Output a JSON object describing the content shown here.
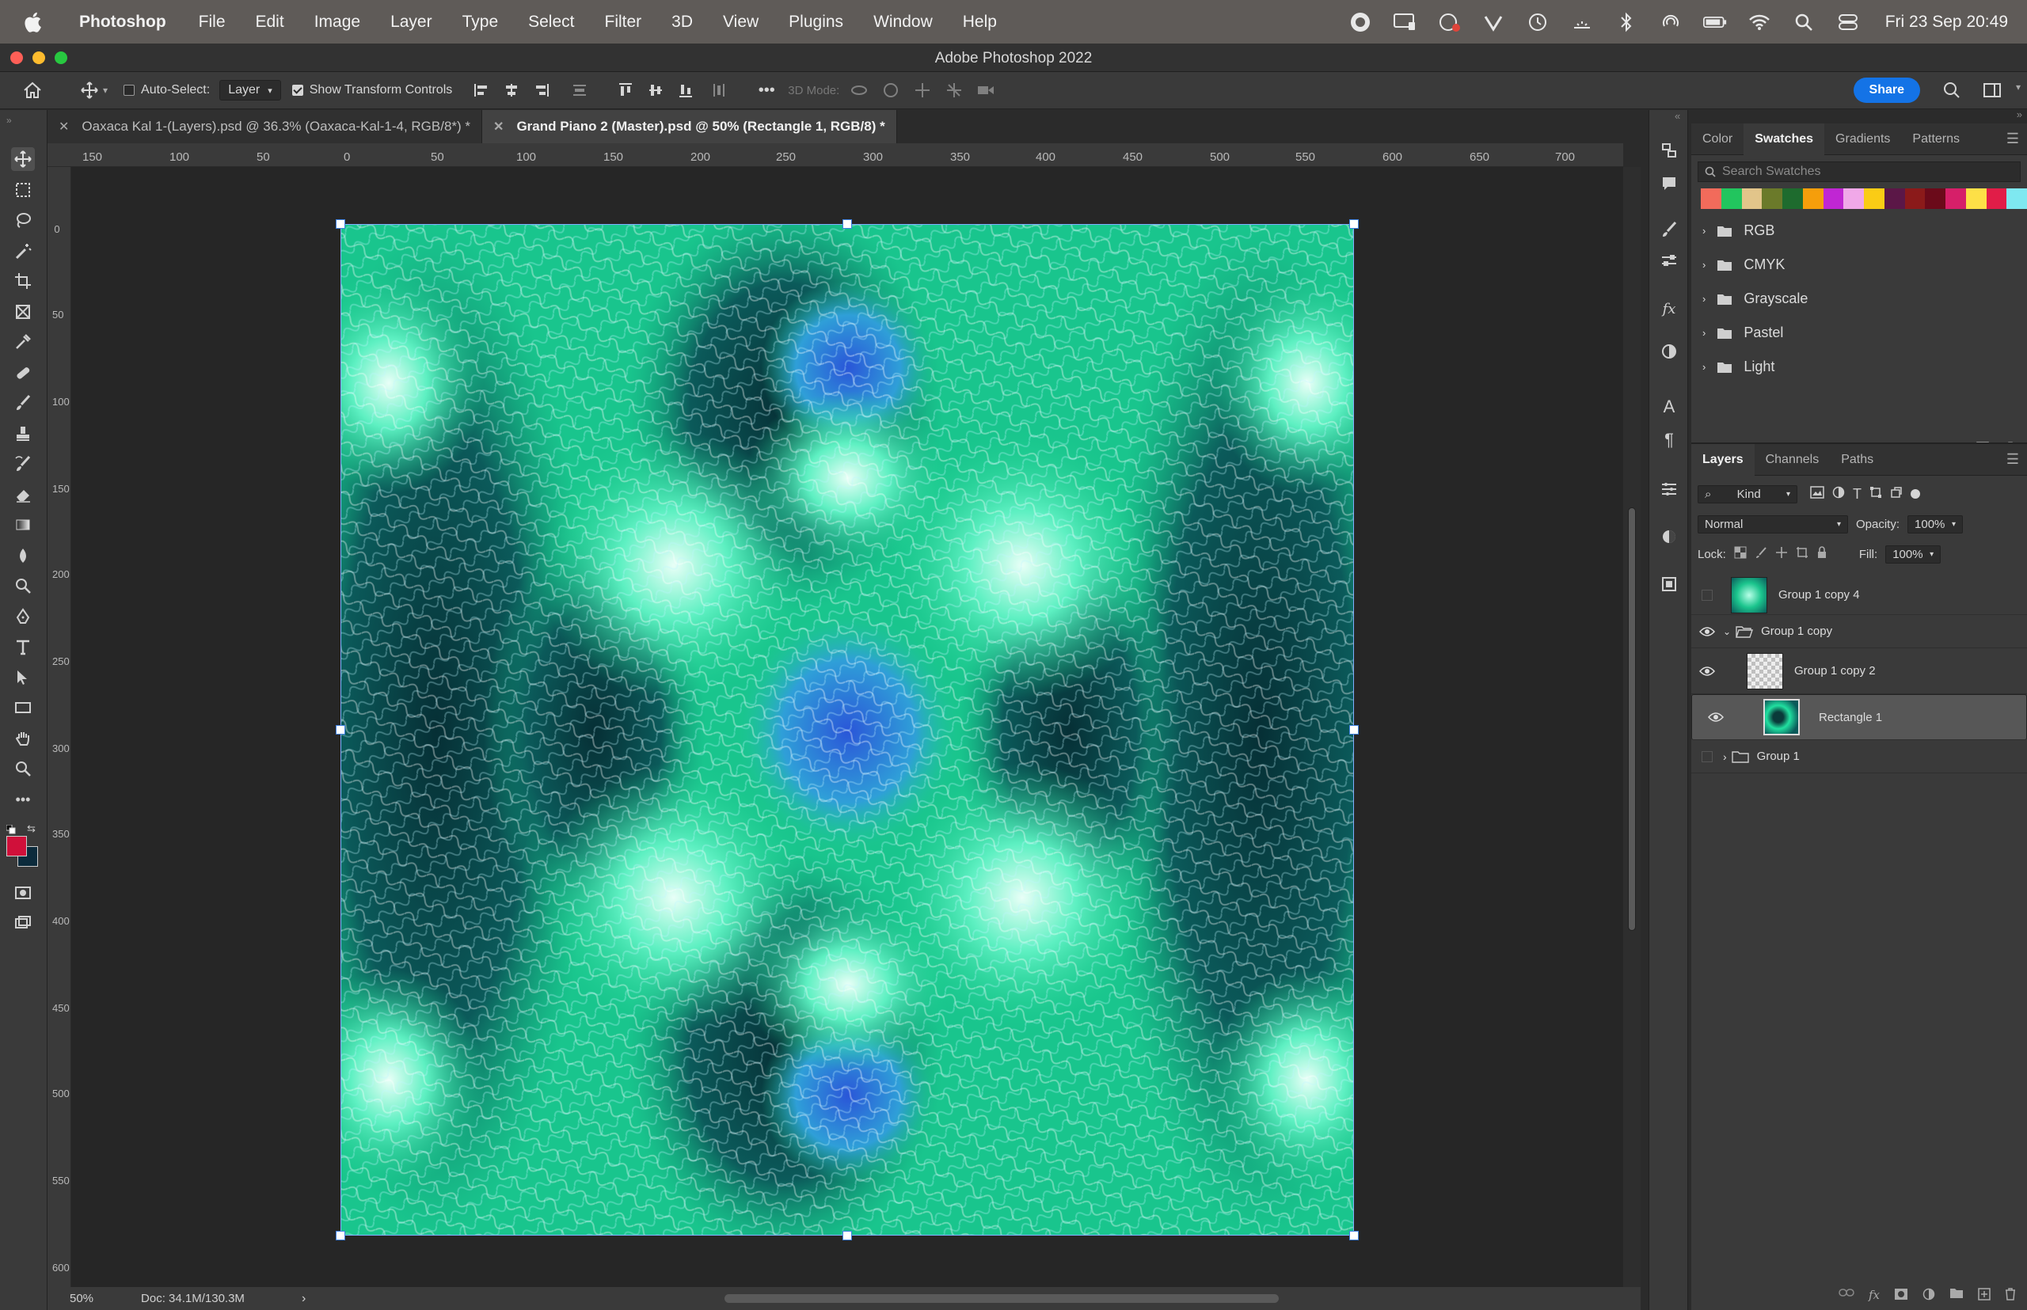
{
  "menubar": {
    "app_name": "Photoshop",
    "menus": [
      "File",
      "Edit",
      "Image",
      "Layer",
      "Type",
      "Select",
      "Filter",
      "3D",
      "View",
      "Plugins",
      "Window",
      "Help"
    ],
    "clock": "Fri 23 Sep  20:49"
  },
  "window": {
    "title": "Adobe Photoshop 2022"
  },
  "options": {
    "auto_select_label": "Auto-Select:",
    "auto_select_value": "Layer",
    "transform_label": "Show Transform Controls",
    "mode_3d": "3D Mode:",
    "share": "Share"
  },
  "tabs": [
    {
      "label": "Oaxaca Kal 1-(Layers).psd @ 36.3% (Oaxaca-Kal-1-4, RGB/8*) *"
    },
    {
      "label": "Grand Piano 2 (Master).psd @ 50% (Rectangle 1, RGB/8) *"
    }
  ],
  "ruler": {
    "top": [
      "150",
      "100",
      "50",
      "0",
      "50",
      "100",
      "150",
      "200",
      "250",
      "300",
      "350",
      "400",
      "450",
      "500",
      "550",
      "600",
      "650",
      "700"
    ],
    "left": [
      "0",
      "50",
      "100",
      "150",
      "200",
      "250",
      "300",
      "350",
      "400",
      "450",
      "500",
      "550",
      "600"
    ]
  },
  "status": {
    "zoom": "50%",
    "doc": "Doc: 34.1M/130.3M"
  },
  "colors": {
    "foreground": "#d0103a",
    "background": "#0c2b3c",
    "accent": "#1473e6"
  },
  "swatches_panel": {
    "tabs": [
      "Color",
      "Swatches",
      "Gradients",
      "Patterns"
    ],
    "search_placeholder": "Search Swatches",
    "colors": [
      "#f26b5b",
      "#22c55e",
      "#e2c58a",
      "#6b7a2a",
      "#1e6b2e",
      "#f59e0b",
      "#c026d3",
      "#f0a8e8",
      "#facc15",
      "#5b1747",
      "#8b1a1a",
      "#6b0a1a",
      "#d61f69",
      "#fde047",
      "#e11d48",
      "#7ee8f0"
    ],
    "folders": [
      "RGB",
      "CMYK",
      "Grayscale",
      "Pastel",
      "Light"
    ]
  },
  "layers_panel": {
    "tabs": [
      "Layers",
      "Channels",
      "Paths"
    ],
    "filter_kind": "Kind",
    "blend_mode": "Normal",
    "opacity_label": "Opacity:",
    "opacity": "100%",
    "lock_label": "Lock:",
    "fill_label": "Fill:",
    "fill": "100%",
    "layers": [
      {
        "name": "Group 1 copy 4",
        "visible": false
      },
      {
        "name": "Group 1 copy",
        "visible": true
      },
      {
        "name": "Group 1 copy 2",
        "visible": true
      },
      {
        "name": "Rectangle 1",
        "visible": true
      },
      {
        "name": "Group 1",
        "visible": false
      }
    ]
  }
}
